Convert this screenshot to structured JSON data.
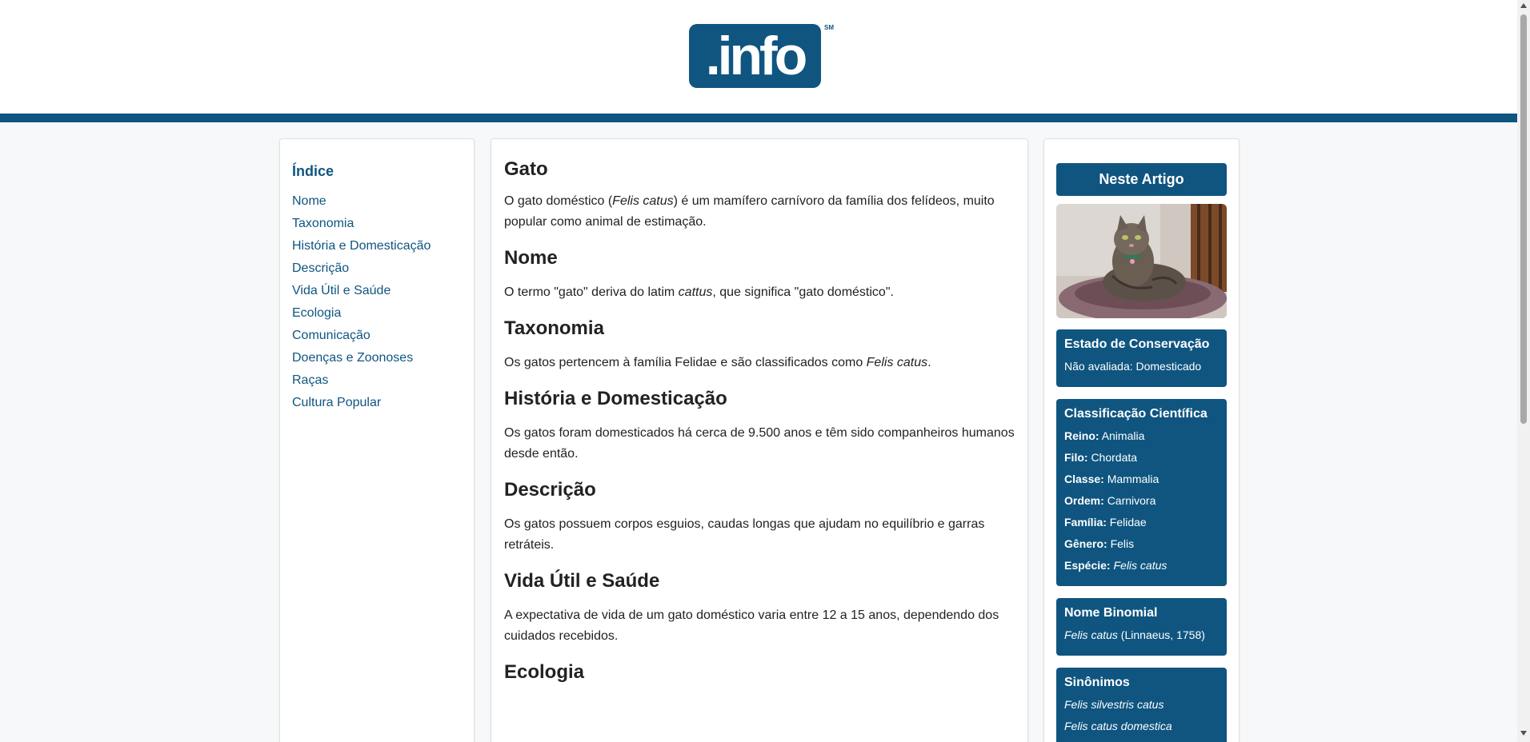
{
  "header": {
    "logo_text": ".info",
    "logo_mark": "SM"
  },
  "toc": {
    "title": "Índice",
    "items": [
      "Nome",
      "Taxonomia",
      "História e Domesticação",
      "Descrição",
      "Vida Útil e Saúde",
      "Ecologia",
      "Comunicação",
      "Doenças e Zoonoses",
      "Raças",
      "Cultura Popular"
    ]
  },
  "article": {
    "title": "Gato",
    "intro": {
      "before": "O gato doméstico (",
      "italic": "Felis catus",
      "after": ") é um mamífero carnívoro da família dos felídeos, muito popular como animal de estimação."
    },
    "sections": [
      {
        "heading": "Nome",
        "before": "O termo \"gato\" deriva do latim ",
        "italic": "cattus",
        "after": ", que significa \"gato doméstico\"."
      },
      {
        "heading": "Taxonomia",
        "before": "Os gatos pertencem à família Felidae e são classificados como ",
        "italic": "Felis catus",
        "after": "."
      },
      {
        "heading": "História e Domesticação",
        "before": "Os gatos foram domesticados há cerca de 9.500 anos e têm sido companheiros humanos desde então.",
        "italic": "",
        "after": ""
      },
      {
        "heading": "Descrição",
        "before": "Os gatos possuem corpos esguios, caudas longas que ajudam no equilíbrio e garras retráteis.",
        "italic": "",
        "after": ""
      },
      {
        "heading": "Vida Útil e Saúde",
        "before": "A expectativa de vida de um gato doméstico varia entre 12 a 15 anos, dependendo dos cuidados recebidos.",
        "italic": "",
        "after": ""
      },
      {
        "heading": "Ecologia",
        "before": "",
        "italic": "",
        "after": ""
      }
    ]
  },
  "sidebar": {
    "header": "Neste Artigo",
    "conservation": {
      "title": "Estado de Conservação",
      "value": "Não avaliada: Domesticado"
    },
    "classification": {
      "title": "Classificação Científica",
      "rows": [
        {
          "label": "Reino:",
          "value": "Animalia"
        },
        {
          "label": "Filo:",
          "value": "Chordata"
        },
        {
          "label": "Classe:",
          "value": "Mammalia"
        },
        {
          "label": "Ordem:",
          "value": "Carnivora"
        },
        {
          "label": "Família:",
          "value": "Felidae"
        },
        {
          "label": "Gênero:",
          "value": "Felis"
        },
        {
          "label": "Espécie:",
          "value": "Felis catus"
        }
      ]
    },
    "binomial": {
      "title": "Nome Binomial",
      "italic": "Felis catus",
      "rest": " (Linnaeus, 1758)"
    },
    "synonyms": {
      "title": "Sinônimos",
      "items": [
        "Felis silvestris catus",
        "Felis catus domestica"
      ]
    }
  },
  "colors": {
    "brand": "#0f5580",
    "background": "#f7f8fa"
  }
}
